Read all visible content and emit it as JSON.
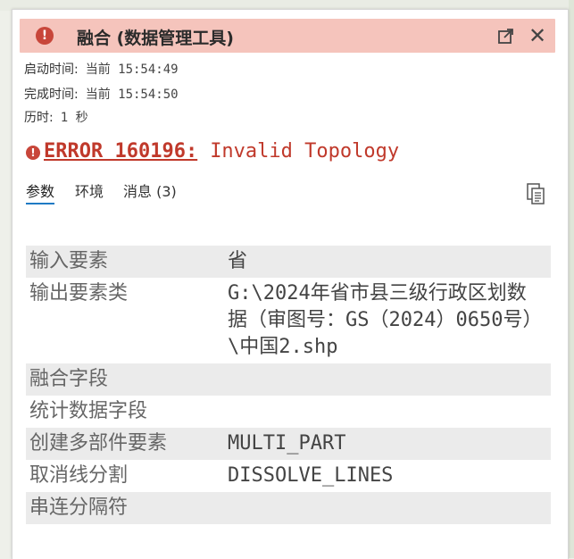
{
  "header": {
    "title": "融合 (数据管理工具)",
    "error_glyph": "!",
    "close_glyph": "✕",
    "status_color": "#f5c4bc"
  },
  "info": {
    "start_label": "启动时间:",
    "start_value": "当前 15:54:49",
    "end_label": "完成时间:",
    "end_value": "当前 15:54:50",
    "duration_label": "历时:",
    "duration_value": "1 秒"
  },
  "error": {
    "code": "ERROR 160196:",
    "message": "Invalid Topology",
    "glyph": "!"
  },
  "tabs": [
    {
      "label": "参数",
      "active": true
    },
    {
      "label": "环境",
      "active": false
    },
    {
      "label": "消息 (3)",
      "active": false
    }
  ],
  "parameters": [
    {
      "name": "输入要素",
      "value": "省"
    },
    {
      "name": "输出要素类",
      "value": "G:\\2024年省市县三级行政区划数据（审图号：GS（2024）0650号）\\中国2.shp"
    },
    {
      "name": "融合字段",
      "value": ""
    },
    {
      "name": "统计数据字段",
      "value": ""
    },
    {
      "name": "创建多部件要素",
      "value": "MULTI_PART"
    },
    {
      "name": "取消线分割",
      "value": "DISSOLVE_LINES"
    },
    {
      "name": "串连分隔符",
      "value": ""
    }
  ]
}
